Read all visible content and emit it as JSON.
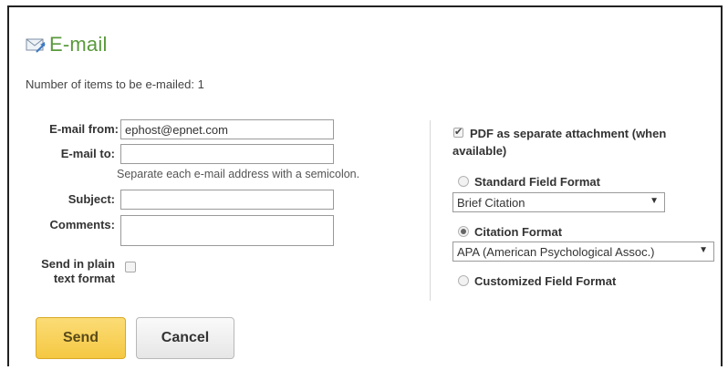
{
  "title": "E-mail",
  "item_count_text": "Number of items to be e-mailed: 1",
  "form": {
    "from_label": "E-mail from:",
    "from_value": "ephost@epnet.com",
    "to_label": "E-mail to:",
    "to_value": "",
    "to_hint": "Separate each e-mail address with a semicolon.",
    "subject_label": "Subject:",
    "subject_value": "",
    "comments_label": "Comments:",
    "comments_value": "",
    "plain_text_label_1": "Send in plain",
    "plain_text_label_2": "text format",
    "plain_text_checked": false
  },
  "options": {
    "pdf_label_1": "PDF as separate attachment (when",
    "pdf_label_2": "available)",
    "pdf_checked": true,
    "standard_label": "Standard Field Format",
    "standard_selected": false,
    "standard_dropdown": "Brief Citation",
    "citation_label": "Citation Format",
    "citation_selected": true,
    "citation_dropdown": "APA (American Psychological Assoc.)",
    "customized_label": "Customized Field Format",
    "customized_selected": false
  },
  "buttons": {
    "send": "Send",
    "cancel": "Cancel"
  },
  "icons": {
    "title_icon": "email-envelope-icon",
    "dropdown_arrow": "triangle-down-icon"
  },
  "colors": {
    "title": "#5a9a3c",
    "send_button": "#f5c842"
  }
}
